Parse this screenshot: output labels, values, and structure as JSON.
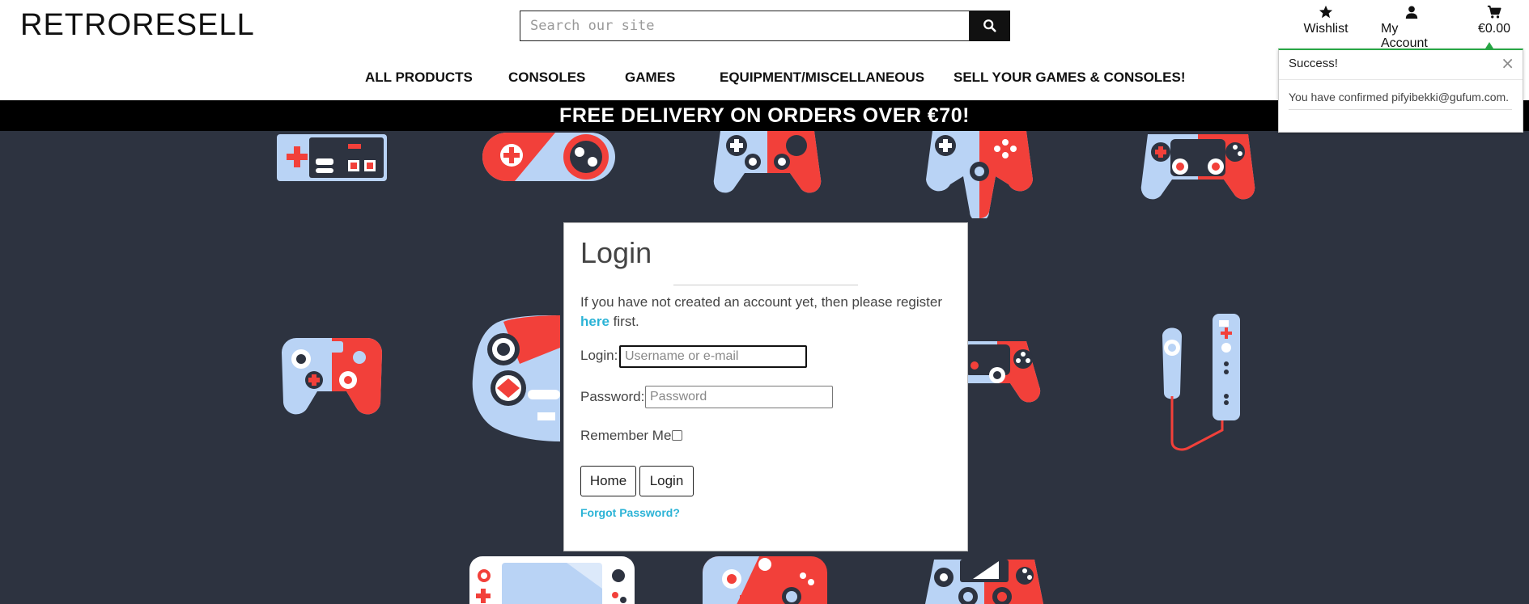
{
  "brand": {
    "logo": "RETRORESELL"
  },
  "search": {
    "placeholder": "Search our site"
  },
  "utility": {
    "wishlist": {
      "label": "Wishlist",
      "icon": "star-icon"
    },
    "account": {
      "label": "My Account",
      "icon": "user-icon"
    },
    "cart": {
      "label": "€0.00",
      "icon": "cart-icon"
    }
  },
  "nav": {
    "items": [
      {
        "label": "ALL PRODUCTS"
      },
      {
        "label": "CONSOLES"
      },
      {
        "label": "GAMES"
      },
      {
        "label": "EQUIPMENT/MISCELLANEOUS"
      },
      {
        "label": "SELL YOUR GAMES & CONSOLES!"
      }
    ]
  },
  "banner": {
    "text": "FREE DELIVERY ON ORDERS OVER €70!"
  },
  "toast": {
    "title": "Success!",
    "close": "×",
    "message": "You have confirmed pifyibekki@gufum.com.",
    "accent": "#28a745"
  },
  "login": {
    "title": "Login",
    "intro_before": "If you have not created an account yet, then please register",
    "intro_link": "here",
    "intro_after": "first.",
    "login_label": "Login:",
    "login_placeholder": "Username or e-mail",
    "password_label": "Password:",
    "password_placeholder": "Password",
    "remember_label": "Remember Me:",
    "home_button": "Home",
    "login_button": "Login",
    "forgot_link": "Forgot Password?"
  },
  "colors": {
    "background": "#2d3340",
    "controller_light": "#b9d3f5",
    "controller_red": "#f2403a",
    "link": "#2bb3d6"
  }
}
